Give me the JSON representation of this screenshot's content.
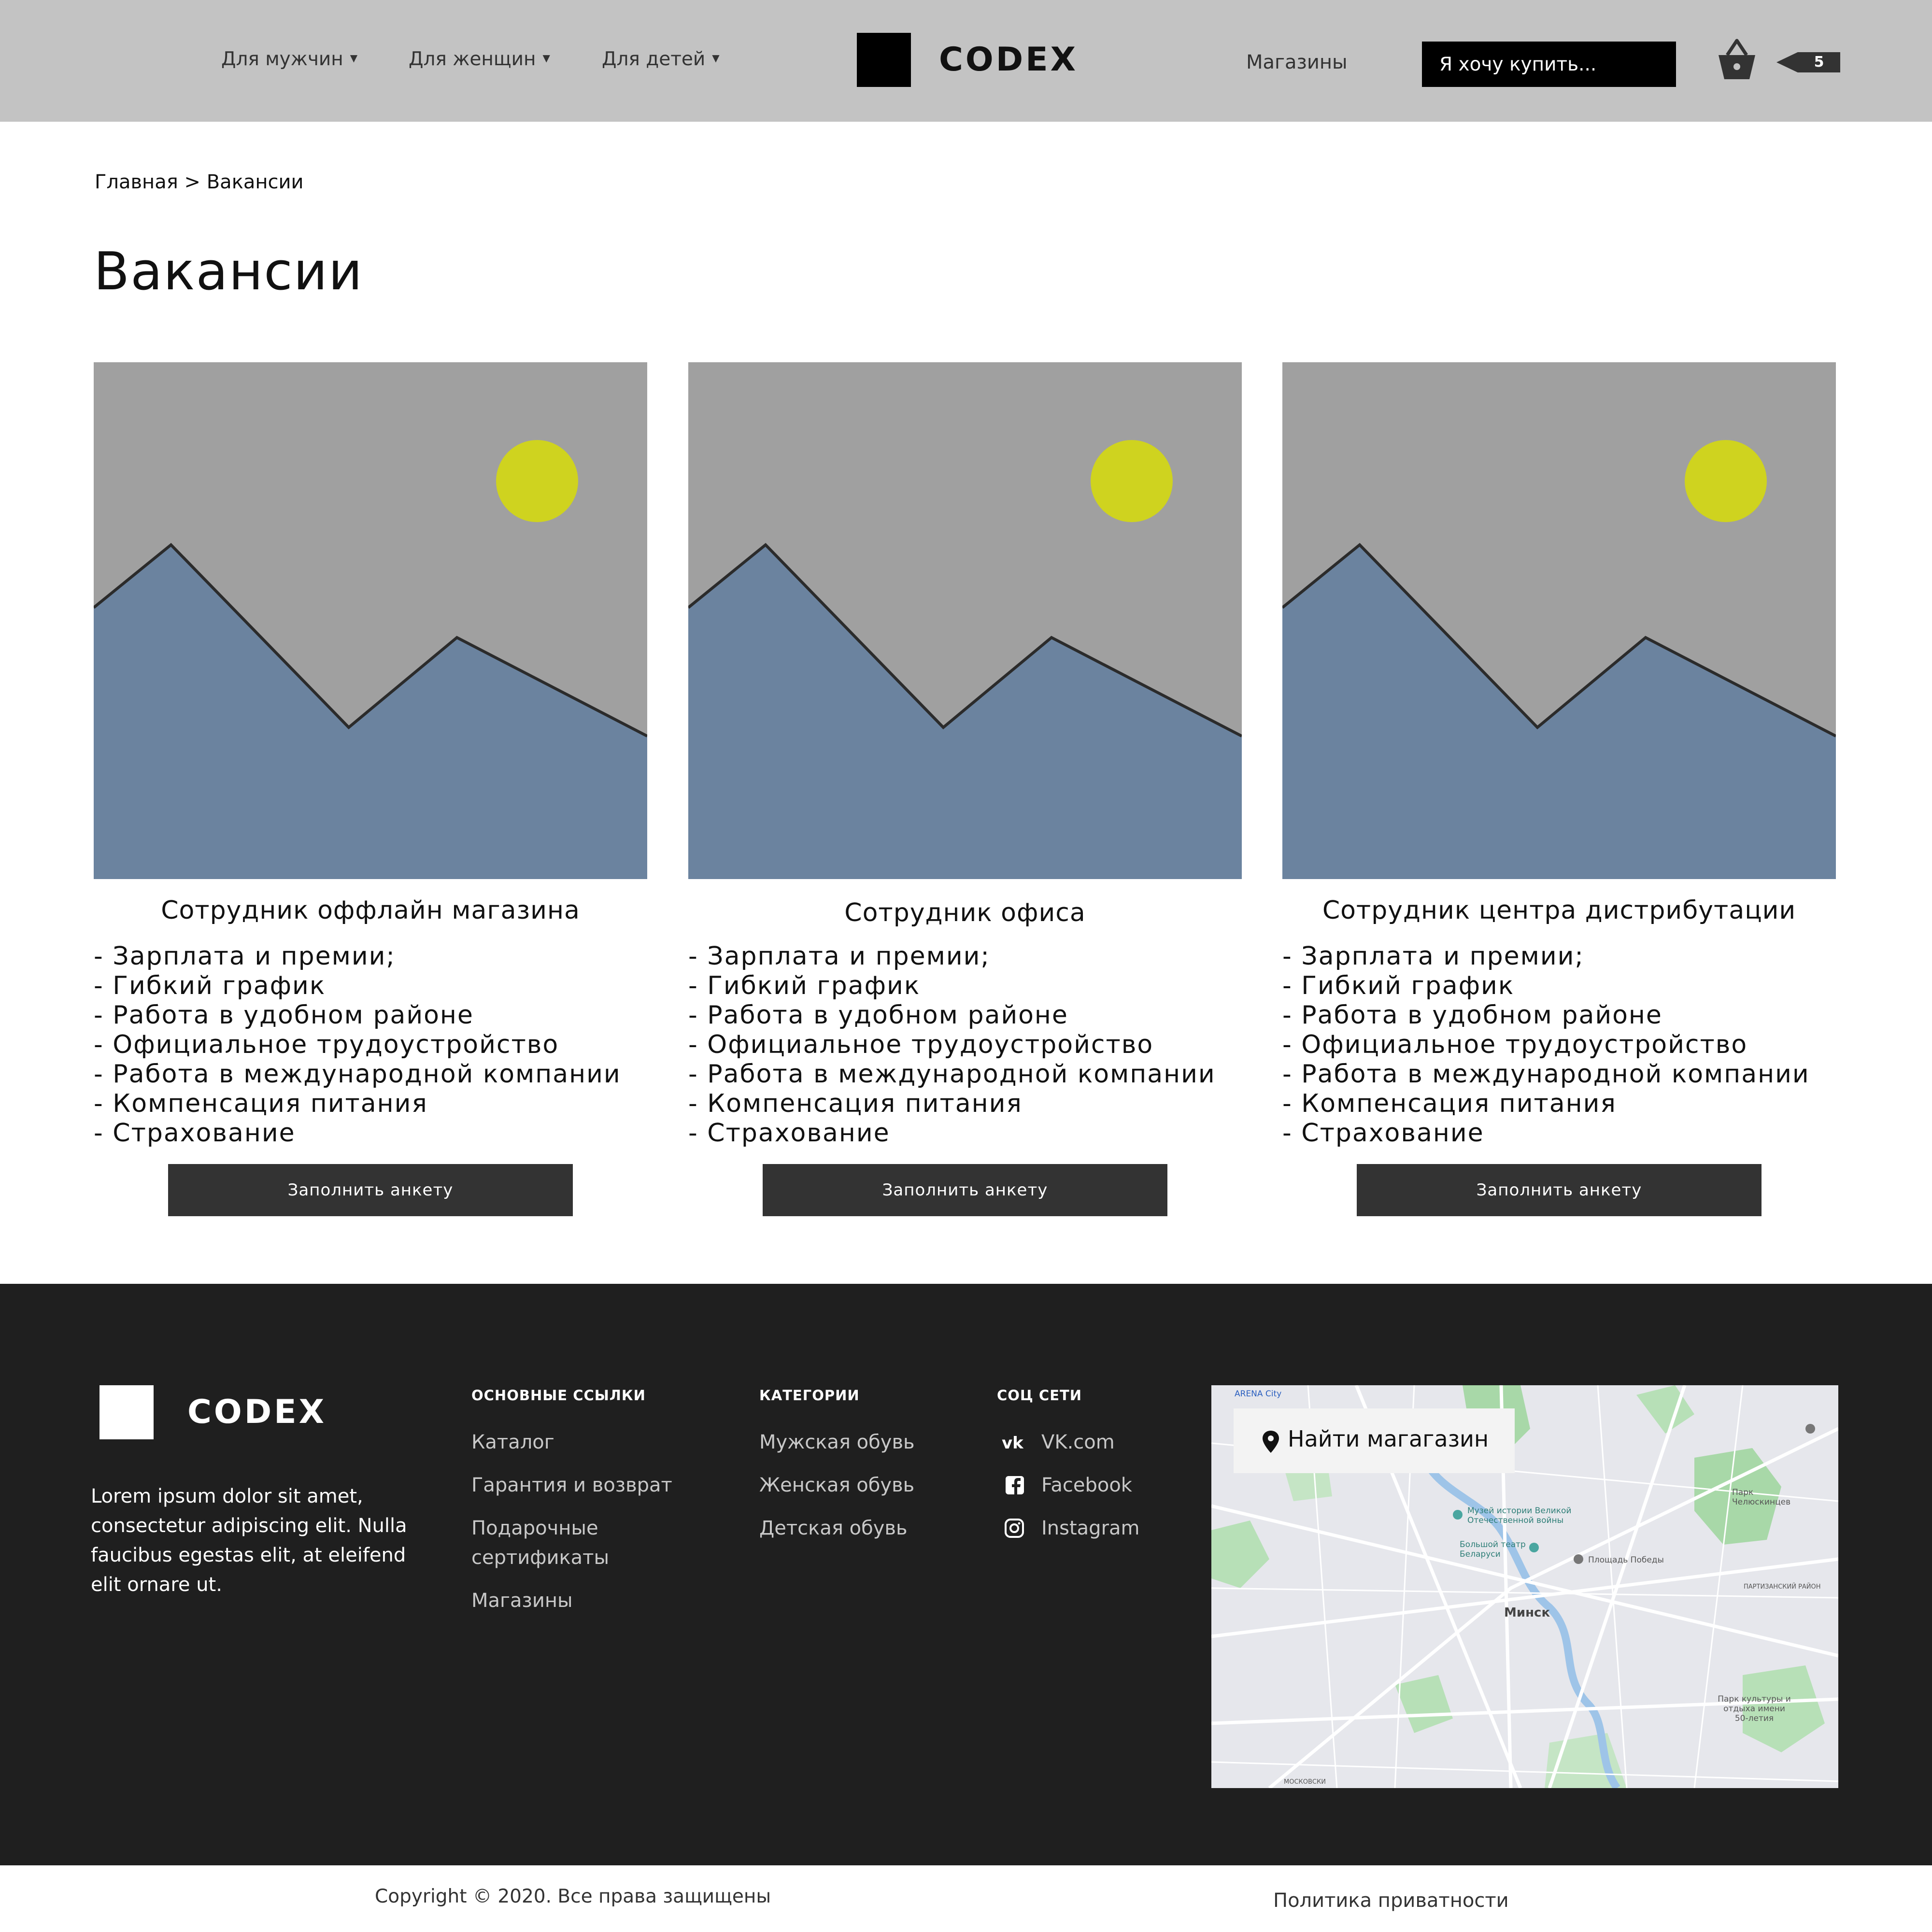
{
  "header": {
    "nav": [
      {
        "label": "Для мужчин"
      },
      {
        "label": "Для женщин"
      },
      {
        "label": "Для детей"
      }
    ],
    "logo_text": "CODEX",
    "stores_link": "Магазины",
    "search_placeholder": "Я хочу купить...",
    "cart_count": "5"
  },
  "breadcrumb": {
    "home": "Главная",
    "separator": ">",
    "current": "Вакансии"
  },
  "page_title": "Вакансии",
  "vacancies": [
    {
      "title": "Сотрудник оффлайн магазина",
      "benefits": [
        "- Зарплата и премии;",
        "- Гибкий график",
        "- Работа в удобном районе",
        "- Официальное трудоустройство",
        "- Работа в международной компании",
        "- Компенсация питания",
        "- Страхование"
      ],
      "button": "Заполнить анкету"
    },
    {
      "title": "Сотрудник офиса",
      "benefits": [
        "- Зарплата и премии;",
        "- Гибкий график",
        "- Работа в удобном районе",
        "- Официальное трудоустройство",
        "- Работа в международной компании",
        "- Компенсация питания",
        "- Страхование"
      ],
      "button": "Заполнить анкету"
    },
    {
      "title": "Сотрудник центра дистрибутации",
      "benefits": [
        "- Зарплата и премии;",
        "- Гибкий график",
        "- Работа в удобном районе",
        "- Официальное трудоустройство",
        "- Работа в международной компании",
        "- Компенсация питания",
        "- Страхование"
      ],
      "button": "Заполнить анкету"
    }
  ],
  "placeholder_image": {
    "icon": "image-placeholder-icon",
    "sky_color": "#a0a0a0",
    "mountain_color": "#6b839f",
    "sun_color": "#cfd31f"
  },
  "footer": {
    "logo_text": "CODEX",
    "description": "Lorem ipsum dolor sit amet, consectetur adipiscing elit. Nulla faucibus egestas elit, at eleifend elit ornare ut.",
    "columns": {
      "main_links": {
        "title": "ОСНОВНЫЕ ССЫЛКИ",
        "items": [
          "Каталог",
          "Гарантия и возврат",
          "Подарочные сертификаты",
          "Магазины"
        ]
      },
      "categories": {
        "title": "КАТЕГОРИИ",
        "items": [
          "Мужская обувь",
          "Женская обувь",
          "Детская обувь"
        ]
      },
      "social": {
        "title": "СОЦ СЕТИ",
        "items": [
          {
            "label": "VK.com",
            "icon": "vk-icon"
          },
          {
            "label": "Facebook",
            "icon": "facebook-icon"
          },
          {
            "label": "Instagram",
            "icon": "instagram-icon"
          }
        ]
      }
    },
    "map": {
      "find_store": "Найти магагазин",
      "labels": {
        "city": "Минск",
        "arena": "ARENA City",
        "museum": "Музей истории Великой Отечественной войны",
        "theatre": "Большой театр Беларуси",
        "square": "Площадь Победы",
        "park_chel": "Парк Челюскинцев",
        "partizan": "ПАРТИЗАНСКИЙ РАЙОН",
        "park_50": "Парк культуры и отдыха имени 50-летия",
        "moskov": "МОСКОВСКИ"
      }
    }
  },
  "bottom": {
    "copyright": "Copyright © 2020. Все права защищены",
    "privacy": "Политика приватности"
  },
  "colors": {
    "header_bg": "#c3c3c3",
    "footer_bg": "#1f1f1f",
    "button_bg": "#333333"
  }
}
